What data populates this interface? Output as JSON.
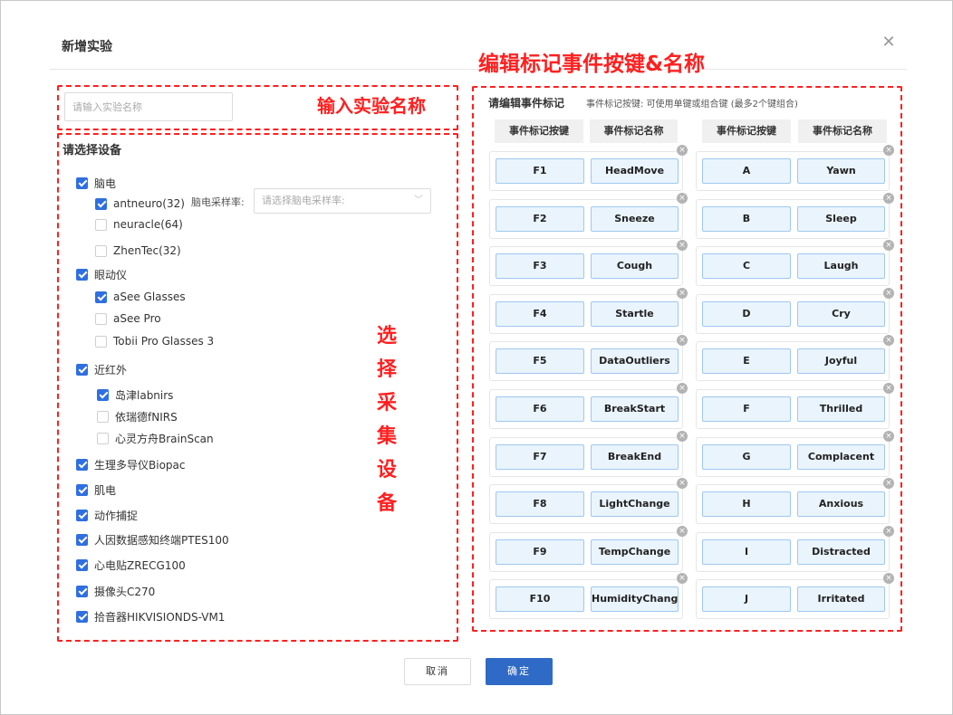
{
  "dialog": {
    "title": "新增实验",
    "close_icon": "close-icon"
  },
  "experiment_name": {
    "placeholder": "请输入实验名称",
    "annotation": "输入实验名称"
  },
  "devices": {
    "title": "请选择设备",
    "annotation": "选择采集设备",
    "annotation_chars": [
      "选",
      "择",
      "采",
      "集",
      "设",
      "备"
    ],
    "eeg": {
      "label": "脑电",
      "checked": true
    },
    "eeg_sub": [
      {
        "label": "antneuro(32)",
        "checked": true
      },
      {
        "label": "neuracle(64)",
        "checked": false
      },
      {
        "label": "ZhenTec(32)",
        "checked": false
      }
    ],
    "eeg_rate_label": "脑电采样率:",
    "eeg_rate_placeholder": "请选择脑电采样率:",
    "eye": {
      "label": "眼动仪",
      "checked": true
    },
    "eye_sub": [
      {
        "label": "aSee Glasses",
        "checked": true
      },
      {
        "label": "aSee Pro",
        "checked": false
      },
      {
        "label": "Tobii Pro Glasses 3",
        "checked": false
      }
    ],
    "nirs": {
      "label": "近红外",
      "checked": true
    },
    "nirs_sub": [
      {
        "label": "岛津labnirs",
        "checked": true
      },
      {
        "label": "依瑞德fNIRS",
        "checked": false
      },
      {
        "label": "心灵方舟BrainScan",
        "checked": false
      }
    ],
    "others": [
      {
        "label": "生理多导仪Biopac",
        "checked": true
      },
      {
        "label": "肌电",
        "checked": true
      },
      {
        "label": "动作捕捉",
        "checked": true
      },
      {
        "label": "人因数据感知终端PTES100",
        "checked": true
      },
      {
        "label": "心电贴ZRECG100",
        "checked": true
      },
      {
        "label": "摄像头C270",
        "checked": true
      },
      {
        "label": "拾音器HIKVISIONDS-VM1",
        "checked": true
      }
    ]
  },
  "events": {
    "annotation": "编辑标记事件按键&名称",
    "title": "请编辑事件标记",
    "hint": "事件标记按键: 可使用单键或组合键 (最多2个键组合)",
    "col_key": "事件标记按键",
    "col_name": "事件标记名称",
    "left": [
      {
        "key": "F1",
        "name": "HeadMove"
      },
      {
        "key": "F2",
        "name": "Sneeze"
      },
      {
        "key": "F3",
        "name": "Cough"
      },
      {
        "key": "F4",
        "name": "Startle"
      },
      {
        "key": "F5",
        "name": "DataOutliers"
      },
      {
        "key": "F6",
        "name": "BreakStart"
      },
      {
        "key": "F7",
        "name": "BreakEnd"
      },
      {
        "key": "F8",
        "name": "LightChange"
      },
      {
        "key": "F9",
        "name": "TempChange"
      },
      {
        "key": "F10",
        "name": "HumidityChange"
      }
    ],
    "right": [
      {
        "key": "A",
        "name": "Yawn"
      },
      {
        "key": "B",
        "name": "Sleep"
      },
      {
        "key": "C",
        "name": "Laugh"
      },
      {
        "key": "D",
        "name": "Cry"
      },
      {
        "key": "E",
        "name": "Joyful"
      },
      {
        "key": "F",
        "name": "Thrilled"
      },
      {
        "key": "G",
        "name": "Complacent"
      },
      {
        "key": "H",
        "name": "Anxious"
      },
      {
        "key": "I",
        "name": "Distracted"
      },
      {
        "key": "J",
        "name": "Irritated"
      }
    ],
    "delete_glyph": "×"
  },
  "footer": {
    "cancel_label": "取消",
    "ok_label": "确定"
  },
  "colors": {
    "accent": "#2f6bc6",
    "annotation_red": "#ff1f1f",
    "checkbox_blue": "#2f6fe0"
  }
}
